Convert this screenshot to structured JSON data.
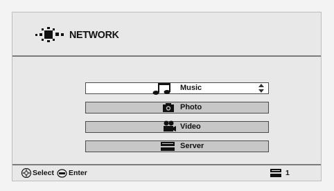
{
  "header": {
    "title": "NETWORK",
    "icon": "network-icon"
  },
  "menu": {
    "items": [
      {
        "label": "Music",
        "icon": "music-note-icon",
        "selected": true
      },
      {
        "label": "Photo",
        "icon": "camera-icon",
        "selected": false
      },
      {
        "label": "Video",
        "icon": "video-camera-icon",
        "selected": false
      },
      {
        "label": "Server",
        "icon": "server-icon",
        "selected": false
      }
    ]
  },
  "footer": {
    "select_label": "Select",
    "enter_label": "Enter",
    "server_count": "1"
  }
}
